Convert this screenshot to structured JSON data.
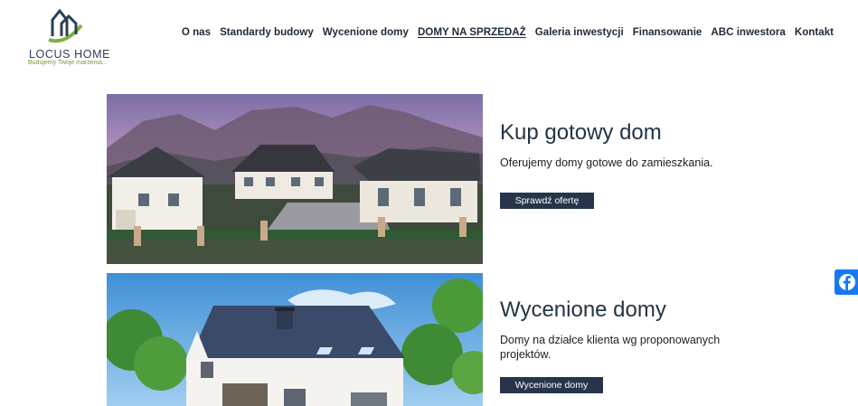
{
  "brand": {
    "name": "LOCUS HOME",
    "tagline": "Budujemy Twoje marzenia..."
  },
  "nav": {
    "items": [
      {
        "label": "O nas",
        "active": false
      },
      {
        "label": "Standardy budowy",
        "active": false
      },
      {
        "label": "Wycenione domy",
        "active": false
      },
      {
        "label": "DOMY NA SPRZEDAŻ",
        "active": true
      },
      {
        "label": "Galeria inwestycji",
        "active": false
      },
      {
        "label": "Finansowanie",
        "active": false
      },
      {
        "label": "ABC inwestora",
        "active": false
      },
      {
        "label": "Kontakt",
        "active": false
      }
    ]
  },
  "sections": [
    {
      "title": "Kup gotowy dom",
      "description": "Oferujemy domy gotowe do zamieszkania.",
      "button": "Sprawdź ofertę"
    },
    {
      "title": "Wycenione domy",
      "description": "Domy na działce klienta wg proponowanych projektów.",
      "button": "Wycenione domy"
    }
  ],
  "social": {
    "icon": "facebook-icon"
  },
  "colors": {
    "nav_text": "#1e2b39",
    "button_bg": "#26354a",
    "logo_green": "#6f9a3c",
    "facebook": "#1877f2"
  }
}
